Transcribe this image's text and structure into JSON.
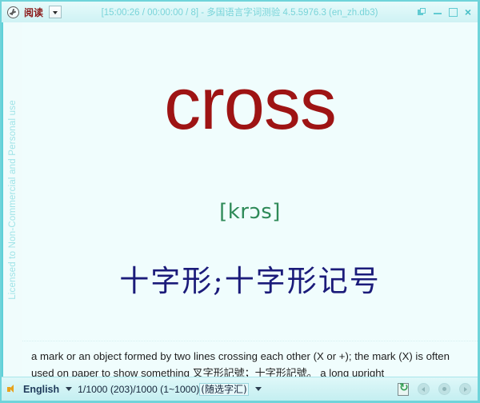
{
  "window": {
    "title_bar": {
      "app_icon": "clock-icon",
      "mode_label": "阅读",
      "mode_dropdown_icon": "chevron-down-icon",
      "title": "[15:00:26 / 00:00:00 / 8] - 多国语言字词测验 4.5.5976.3 (en_zh.db3)",
      "title_time_segment": "[15:00:26 / 00:00:00 / 8] - ",
      "title_app_name": "多国语言字词测验",
      "title_version": " 4.5.5976.3 (en_zh.db3)",
      "buttons": {
        "pin_label": "always-on-top",
        "minimize_label": "minimize",
        "maximize_label": "maximize",
        "close_label": "×"
      }
    },
    "license_strip": {
      "text": "Licensed to Non-Commercial and Personal use"
    },
    "main": {
      "headword": "cross",
      "phonetic": "[krɔs]",
      "translation": "十字形;十字形记号",
      "definition_part1": "a mark or an object formed by two lines crossing each other (X or +); the mark (X) is often used on paper to show something ",
      "definition_cn": "叉字形記號；十字形記號。",
      "definition_part2": "  a long upright"
    },
    "status_bar": {
      "speaker_icon": "speaker-icon",
      "language": "English",
      "language_dropdown_icon": "chevron-down-icon",
      "counter": "1/1000 (203)/1000 (1~1000)",
      "scope": "(随选字汇)",
      "scope_dropdown_icon": "chevron-down-icon",
      "refresh_icon": "refresh-icon",
      "prev_label": "previous",
      "stop_label": "stop",
      "next_label": "next"
    }
  },
  "colors": {
    "accent_teal": "#6fd4da",
    "headword_red": "#9e1414",
    "phonetic_green": "#2e8a58",
    "translation_navy": "#1b1b7a",
    "canvas": "#f0fdfd",
    "speaker_gold": "#e8a21c"
  }
}
